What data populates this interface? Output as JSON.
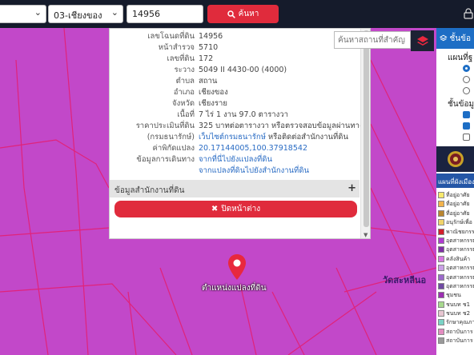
{
  "topbar": {
    "province_select": "",
    "district_select": "03-เชียงของ",
    "parcel_input": "14956",
    "search_label": "ค้นหา"
  },
  "popup": {
    "rows": [
      {
        "label": "เลขโฉนดที่ดิน",
        "value": "14956"
      },
      {
        "label": "หน้าสำรวจ",
        "value": "5710"
      },
      {
        "label": "เลขที่ดิน",
        "value": "172"
      },
      {
        "label": "ระวาง",
        "value": "5049 II 4430-00 (4000)"
      },
      {
        "label": "ตำบล",
        "value": "สถาน"
      },
      {
        "label": "อำเภอ",
        "value": "เชียงของ"
      },
      {
        "label": "จังหวัด",
        "value": "เชียงราย"
      },
      {
        "label": "เนื้อที่",
        "value": "7 ไร่ 1 งาน 97.0 ตารางวา"
      },
      {
        "label": "ราคาประเมินที่ดิน",
        "value": "325 บาทต่อตารางวา หรือตรวจสอบข้อมูลผ่านทาง"
      },
      {
        "label": "(กรมธนารักษ์)",
        "value": "เว็บไซต์กรมธนารักษ์",
        "value_extra": " หรือติดต่อสำนักงานที่ดิน"
      },
      {
        "label": "ค่าพิกัดแปลง",
        "value": "20.17144005,100.37918542"
      },
      {
        "label": "ข้อมูลการเดินทาง",
        "value": "จากที่นี่ไปยังแปลงที่ดิน"
      },
      {
        "label": "",
        "value": "จากแปลงที่ดินไปยังสำนักงานที่ดิน"
      }
    ],
    "office_section": "ข้อมูลสำนักงานที่ดิน",
    "close_label": "ปิดหน้าต่าง"
  },
  "map": {
    "landmark_placeholder": "ค้นหาสถานที่สำคัญ",
    "place_label": "วัดสะหลีนอ",
    "marker_label": "ตำแหน่งแปลงที่ดิน",
    "marker_color": "#e8283e",
    "parcel_line_color": "#e0237a"
  },
  "right_panel": {
    "header": "ชั้นข้อ",
    "map_type_label": "แผนที่ฐ",
    "layers_label": "ชั้นข้อมูล",
    "legend_header": "แผนที่ผังเมืองรวม",
    "legend": [
      {
        "label": "ที่อยู่อาศัย",
        "color": "#f7e96c"
      },
      {
        "label": "ที่อยู่อาศัย",
        "color": "#f2b34c"
      },
      {
        "label": "ที่อยู่อาศัย",
        "color": "#b9852f"
      },
      {
        "label": "อนุรักษ์เพื่อ",
        "color": "#f0d36a"
      },
      {
        "label": "พาณิชยกรรม",
        "color": "#d21f2b"
      },
      {
        "label": "อุตสาหกรรม",
        "color": "#b03ad1"
      },
      {
        "label": "อุตสาหกรรม",
        "color": "#7f2fa5"
      },
      {
        "label": "คลังสินค้า",
        "color": "#d676e0"
      },
      {
        "label": "อุตสาหกรรม",
        "color": "#c9a0e6"
      },
      {
        "label": "อุตสาหกรรม",
        "color": "#9b6acb"
      },
      {
        "label": "อุตสาหกรรม",
        "color": "#6f4aa3"
      },
      {
        "label": "ชุมชน",
        "color": "#9b2fb1"
      },
      {
        "label": "ชนบท ช1",
        "color": "#a7d98e"
      },
      {
        "label": "ชนบท ช2",
        "color": "#e7c6d1"
      },
      {
        "label": "รักษาคุณภาพ",
        "color": "#7ad3c6"
      },
      {
        "label": "สถาบันการ",
        "color": "#e38cc0"
      },
      {
        "label": "สถาบันการ",
        "color": "#9a9a9a"
      }
    ]
  }
}
